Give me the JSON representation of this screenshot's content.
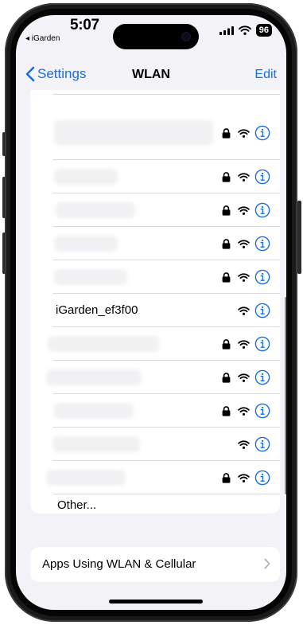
{
  "status_bar": {
    "time": "5:07",
    "back_app": "◂ iGarden",
    "battery": "96"
  },
  "nav": {
    "back_label": "Settings",
    "title": "WLAN",
    "edit_label": "Edit"
  },
  "networks": [
    {
      "name": "",
      "secured": true,
      "obscured": true
    },
    {
      "name": "",
      "secured": true,
      "obscured": true
    },
    {
      "name": "",
      "secured": true,
      "obscured": true
    },
    {
      "name": "",
      "secured": true,
      "obscured": true
    },
    {
      "name": "",
      "secured": true,
      "obscured": true
    },
    {
      "name": "iGarden_ef3f00",
      "secured": false,
      "obscured": false
    },
    {
      "name": "",
      "secured": true,
      "obscured": true
    },
    {
      "name": "",
      "secured": true,
      "obscured": true
    },
    {
      "name": "",
      "secured": true,
      "obscured": true
    },
    {
      "name": "",
      "secured": false,
      "obscured": true
    },
    {
      "name": "",
      "secured": true,
      "obscured": true
    }
  ],
  "other_label": "Other...",
  "apps_wlan_label": "Apps Using WLAN & Cellular",
  "colors": {
    "accent": "#1a6de3",
    "background": "#f2f2f7",
    "card": "#ffffff"
  },
  "icons": {
    "back": "chevron-left-icon",
    "lock": "lock-icon",
    "wifi": "wifi-icon",
    "info": "info-circle-icon",
    "chevron": "chevron-right-icon"
  }
}
